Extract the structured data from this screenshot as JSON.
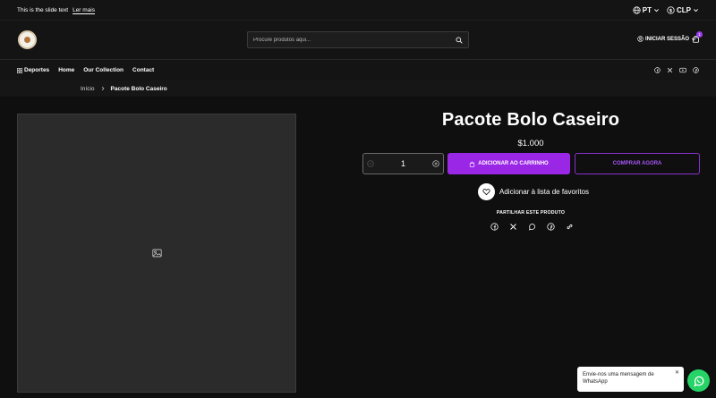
{
  "announcement": {
    "text": "This is the slide text",
    "link": "Ler mais"
  },
  "locale": {
    "language": "PT",
    "currency": "CLP"
  },
  "header": {
    "search_placeholder": "Procure produtos aqui...",
    "login_label": "INICIAR SESSÃO",
    "cart_count": "1"
  },
  "nav": {
    "items": [
      {
        "label": "Deportes"
      },
      {
        "label": "Home"
      },
      {
        "label": "Our Collection"
      },
      {
        "label": "Contact"
      }
    ],
    "social_icons": [
      "facebook-icon",
      "x-icon",
      "youtube-icon",
      "pinterest-icon"
    ]
  },
  "breadcrumb": {
    "home": "Início",
    "current": "Pacote Bolo Caseiro"
  },
  "product": {
    "title": "Pacote Bolo Caseiro",
    "price": "$1.000",
    "quantity": "1",
    "add_to_cart": "ADICIONAR AO CARRINHO",
    "buy_now": "COMPRAR AGORA",
    "wishlist": "Adicionar à lista de favoritos",
    "share_title": "PARTILHAR ESTE PRODUTO",
    "share_icons": [
      "facebook-icon",
      "x-icon",
      "whatsapp-icon",
      "pinterest-icon",
      "link-icon"
    ]
  },
  "whatsapp": {
    "message": "Envie-nos uma mensagem de WhatsApp",
    "close": "✕"
  },
  "colors": {
    "accent": "#9b27e6",
    "background": "#0f0f0f",
    "whatsapp": "#25d366"
  }
}
